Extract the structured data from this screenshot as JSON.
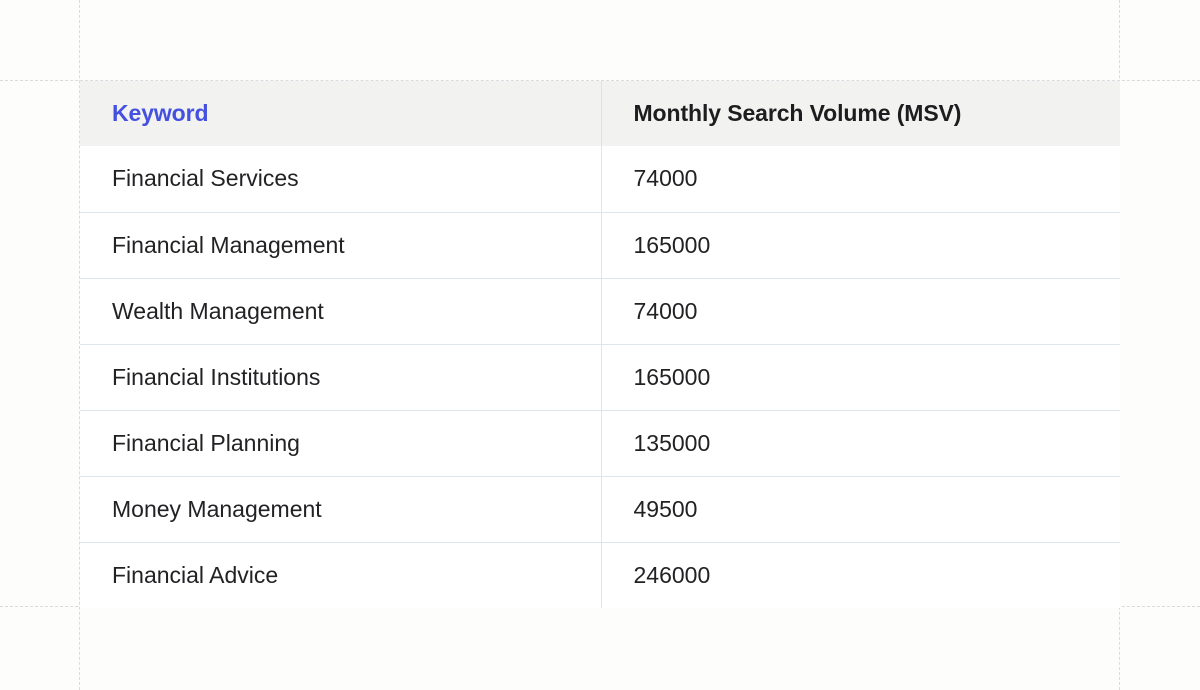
{
  "table": {
    "headers": [
      "Keyword",
      "Monthly Search Volume (MSV)"
    ],
    "rows": [
      {
        "keyword": "Financial Services",
        "msv": "74000"
      },
      {
        "keyword": "Financial Management",
        "msv": "165000"
      },
      {
        "keyword": "Wealth Management",
        "msv": "74000"
      },
      {
        "keyword": "Financial Institutions",
        "msv": "165000"
      },
      {
        "keyword": "Financial Planning",
        "msv": "135000"
      },
      {
        "keyword": "Money Management",
        "msv": "49500"
      },
      {
        "keyword": "Financial Advice",
        "msv": "246000"
      }
    ]
  },
  "colors": {
    "header_accent": "#4450e0",
    "header_background": "#f2f2f0",
    "row_divider": "#dce6ee",
    "guide_lines": "#d9dbdf"
  }
}
